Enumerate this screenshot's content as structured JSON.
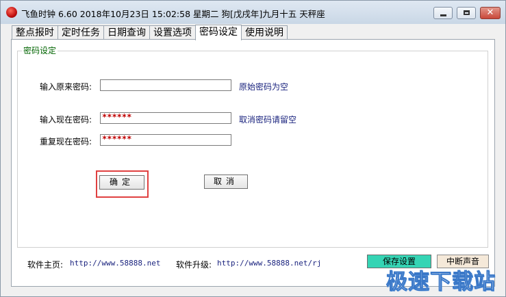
{
  "window": {
    "title": "飞鱼时钟 6.60 2018年10月23日 15:02:58 星期二 狗[戊戌年]九月十五 天秤座",
    "controls": {
      "close": "✕"
    }
  },
  "tabs": [
    {
      "label": "整点报时"
    },
    {
      "label": "定时任务"
    },
    {
      "label": "日期查询"
    },
    {
      "label": "设置选项"
    },
    {
      "label": "密码设定",
      "active": true
    },
    {
      "label": "使用说明"
    }
  ],
  "password_group": {
    "title": "密码设定",
    "original": {
      "label": "输入原来密码:",
      "value": "",
      "hint": "原始密码为空"
    },
    "current": {
      "label": "输入现在密码:",
      "value": "******",
      "hint": "取消密码请留空"
    },
    "repeat": {
      "label": "重复现在密码:",
      "value": "******"
    },
    "confirm_label": "确定",
    "cancel_label": "取消"
  },
  "footer": {
    "homepage_label": "软件主页:",
    "homepage_url": "http://www.58888.net",
    "upgrade_label": "软件升级:",
    "upgrade_url": "http://www.58888.net/rj",
    "save_label": "保存设置",
    "stop_sound_label": "中断声音"
  },
  "watermark": "极速下载站",
  "colors": {
    "group_title": "#006400",
    "hint_text": "#1a237e",
    "password_mask": "#c00000",
    "save_button": "#35d4b4",
    "highlight_box": "#e04040"
  }
}
